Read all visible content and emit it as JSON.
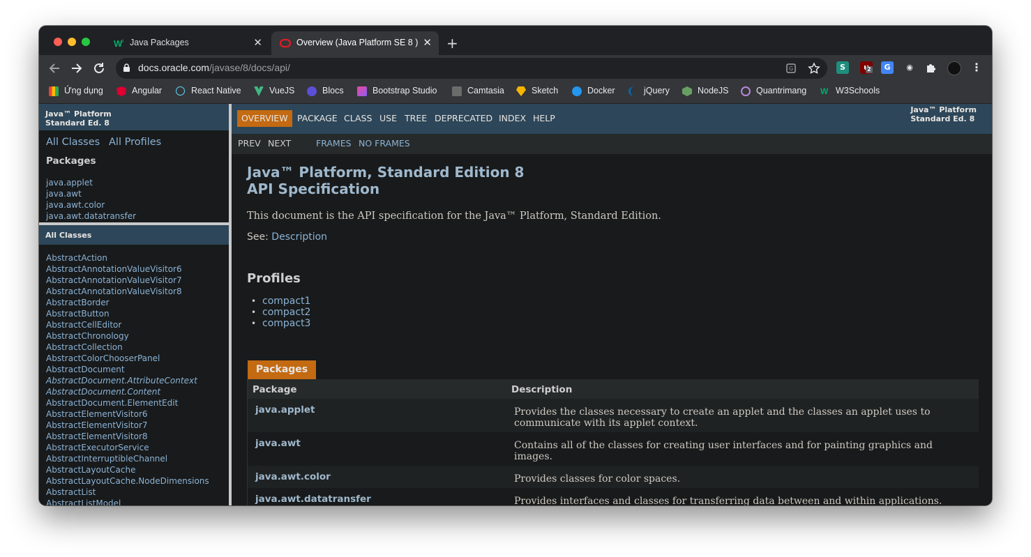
{
  "browser": {
    "tabs": [
      {
        "title": "Java Packages"
      },
      {
        "title": "Overview (Java Platform SE 8 )"
      }
    ],
    "url": {
      "host": "docs.oracle.com",
      "path": "/javase/8/docs/api/"
    },
    "bookmarks": [
      {
        "label": "Ứng dụng",
        "icon": "apps-grid-icon",
        "color": "#e8453c"
      },
      {
        "label": "Angular",
        "icon": "angular-icon",
        "color": "#dd0031"
      },
      {
        "label": "React Native",
        "icon": "react-icon",
        "color": "#61dafb"
      },
      {
        "label": "VueJS",
        "icon": "vue-icon",
        "color": "#41b883"
      },
      {
        "label": "Blocs",
        "icon": "blocs-icon",
        "color": "#5b4fd8"
      },
      {
        "label": "Bootstrap Studio",
        "icon": "bootstrap-studio-icon",
        "color": "#8b5cf6"
      },
      {
        "label": "Camtasia",
        "icon": "camtasia-icon",
        "color": "#6b6b6b"
      },
      {
        "label": "Sketch",
        "icon": "sketch-icon",
        "color": "#f7b500"
      },
      {
        "label": "Docker",
        "icon": "docker-icon",
        "color": "#2496ed"
      },
      {
        "label": "jQuery",
        "icon": "jquery-icon",
        "color": "#0769ad"
      },
      {
        "label": "NodeJS",
        "icon": "nodejs-icon",
        "color": "#68a063"
      },
      {
        "label": "Quantrimang",
        "icon": "quantrimang-icon",
        "color": "#9b59b6"
      },
      {
        "label": "W3Schools",
        "icon": "w3schools-icon",
        "color": "#04aa6d"
      }
    ],
    "extension_badge": "2"
  },
  "left": {
    "header": {
      "line1": "Java™ Platform",
      "line2": "Standard Ed. 8"
    },
    "links": {
      "all_classes": "All Classes",
      "all_profiles": "All Profiles"
    },
    "packages_title": "Packages",
    "packages": [
      "java.applet",
      "java.awt",
      "java.awt.color",
      "java.awt.datatransfer"
    ],
    "classes_header": "All Classes",
    "classes": [
      {
        "name": "AbstractAction",
        "italic": false
      },
      {
        "name": "AbstractAnnotationValueVisitor6",
        "italic": false
      },
      {
        "name": "AbstractAnnotationValueVisitor7",
        "italic": false
      },
      {
        "name": "AbstractAnnotationValueVisitor8",
        "italic": false
      },
      {
        "name": "AbstractBorder",
        "italic": false
      },
      {
        "name": "AbstractButton",
        "italic": false
      },
      {
        "name": "AbstractCellEditor",
        "italic": false
      },
      {
        "name": "AbstractChronology",
        "italic": false
      },
      {
        "name": "AbstractCollection",
        "italic": false
      },
      {
        "name": "AbstractColorChooserPanel",
        "italic": false
      },
      {
        "name": "AbstractDocument",
        "italic": false
      },
      {
        "name": "AbstractDocument.AttributeContext",
        "italic": true
      },
      {
        "name": "AbstractDocument.Content",
        "italic": true
      },
      {
        "name": "AbstractDocument.ElementEdit",
        "italic": false
      },
      {
        "name": "AbstractElementVisitor6",
        "italic": false
      },
      {
        "name": "AbstractElementVisitor7",
        "italic": false
      },
      {
        "name": "AbstractElementVisitor8",
        "italic": false
      },
      {
        "name": "AbstractExecutorService",
        "italic": false
      },
      {
        "name": "AbstractInterruptibleChannel",
        "italic": false
      },
      {
        "name": "AbstractLayoutCache",
        "italic": false
      },
      {
        "name": "AbstractLayoutCache.NodeDimensions",
        "italic": false
      },
      {
        "name": "AbstractList",
        "italic": false
      },
      {
        "name": "AbstractListModel",
        "italic": false
      }
    ]
  },
  "main": {
    "nav": {
      "items": [
        "OVERVIEW",
        "PACKAGE",
        "CLASS",
        "USE",
        "TREE",
        "DEPRECATED",
        "INDEX",
        "HELP"
      ],
      "active": "OVERVIEW",
      "brand_line1": "Java™ Platform",
      "brand_line2": "Standard Ed. 8"
    },
    "subnav": {
      "prev": "PREV",
      "next": "NEXT",
      "frames": "FRAMES",
      "no_frames": "NO FRAMES"
    },
    "title_line1": "Java™ Platform, Standard Edition 8",
    "title_line2": "API Specification",
    "description": "This document is the API specification for the Java™ Platform, Standard Edition.",
    "see_label": "See:",
    "see_link": "Description",
    "profiles_title": "Profiles",
    "profiles": [
      "compact1",
      "compact2",
      "compact3"
    ],
    "packages_caption": "Packages",
    "table_headers": {
      "package": "Package",
      "description": "Description"
    },
    "packages": [
      {
        "name": "java.applet",
        "desc": "Provides the classes necessary to create an applet and the classes an applet uses to communicate with its applet context."
      },
      {
        "name": "java.awt",
        "desc": "Contains all of the classes for creating user interfaces and for painting graphics and images."
      },
      {
        "name": "java.awt.color",
        "desc": "Provides classes for color spaces."
      },
      {
        "name": "java.awt.datatransfer",
        "desc": "Provides interfaces and classes for transferring data between and within applications."
      }
    ]
  }
}
